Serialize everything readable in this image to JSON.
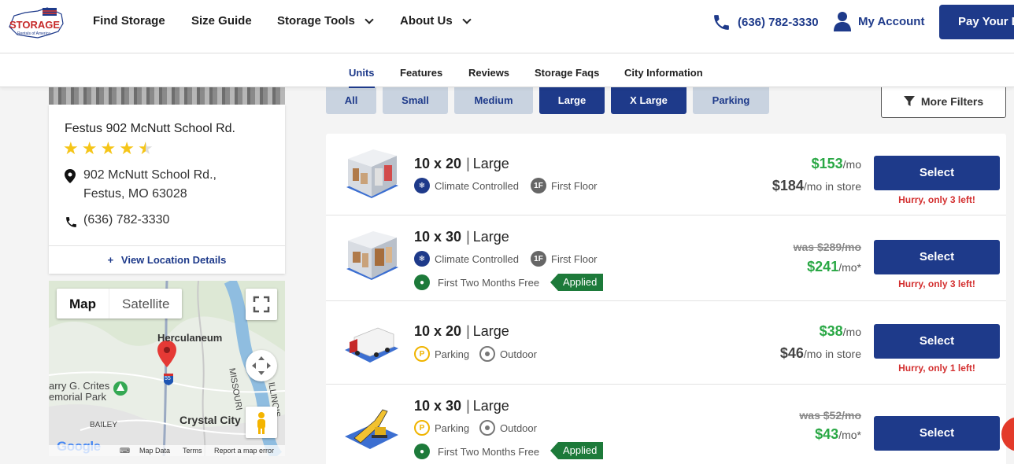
{
  "header": {
    "nav": [
      "Find Storage",
      "Size Guide",
      "Storage Tools",
      "About Us"
    ],
    "phone": "(636) 782-3330",
    "account": "My Account",
    "pay": "Pay Your Bill",
    "logo_text": "STORAGE",
    "logo_sub": "Rentals of America"
  },
  "tabs": [
    "Units",
    "Features",
    "Reviews",
    "Storage Faqs",
    "City Information"
  ],
  "location": {
    "name": "Festus 902 McNutt School Rd.",
    "rating": 4.5,
    "address_line1": "902 McNutt School Rd.,",
    "address_line2": "Festus, MO 63028",
    "phone": "(636) 782-3330",
    "details_link": "View Location Details"
  },
  "map": {
    "map_tab": "Map",
    "satellite_tab": "Satellite",
    "labels": [
      "Herculaneum",
      "Crystal City",
      "BAILEY",
      "arry G. Crites",
      "emorial Park",
      "MISSOURI",
      "ILLINOIS"
    ],
    "highway": "55",
    "footer": [
      "Map Data",
      "Terms",
      "Report a map error"
    ],
    "google": "Google"
  },
  "filters": {
    "sizes": [
      "All",
      "Small",
      "Medium",
      "Large",
      "X Large",
      "Parking"
    ],
    "active": [
      "Large",
      "X Large"
    ],
    "more": "More Filters"
  },
  "units": [
    {
      "size": "10 x 20",
      "category": "Large",
      "features": [
        "Climate Controlled",
        "First Floor"
      ],
      "promo": "",
      "applied": "",
      "was": "",
      "price": "$153",
      "per": "/mo",
      "store_price": "$184",
      "store_per": "/mo in store",
      "select": "Select",
      "hurry": "Hurry, only 3 left!"
    },
    {
      "size": "10 x 30",
      "category": "Large",
      "features": [
        "Climate Controlled",
        "First Floor"
      ],
      "promo": "First Two Months Free",
      "applied": "Applied",
      "was": "was $289/mo",
      "price": "$241",
      "per": "/mo*",
      "store_price": "",
      "store_per": "",
      "select": "Select",
      "hurry": "Hurry, only 3 left!"
    },
    {
      "size": "10 x 20",
      "category": "Large",
      "features": [
        "Parking",
        "Outdoor"
      ],
      "promo": "",
      "applied": "",
      "was": "",
      "price": "$38",
      "per": "/mo",
      "store_price": "$46",
      "store_per": "/mo in store",
      "select": "Select",
      "hurry": "Hurry, only 1 left!"
    },
    {
      "size": "10 x 30",
      "category": "Large",
      "features": [
        "Parking",
        "Outdoor"
      ],
      "promo": "First Two Months Free",
      "applied": "Applied",
      "was": "was $52/mo",
      "price": "$43",
      "per": "/mo*",
      "store_price": "",
      "store_per": "",
      "select": "Select",
      "hurry": ""
    }
  ],
  "colors": {
    "brand": "#1e3a8a",
    "price_green": "#2aa845",
    "promo_green": "#1d7a3a",
    "hurry_red": "#d32f2f",
    "star": "#f5c518"
  }
}
